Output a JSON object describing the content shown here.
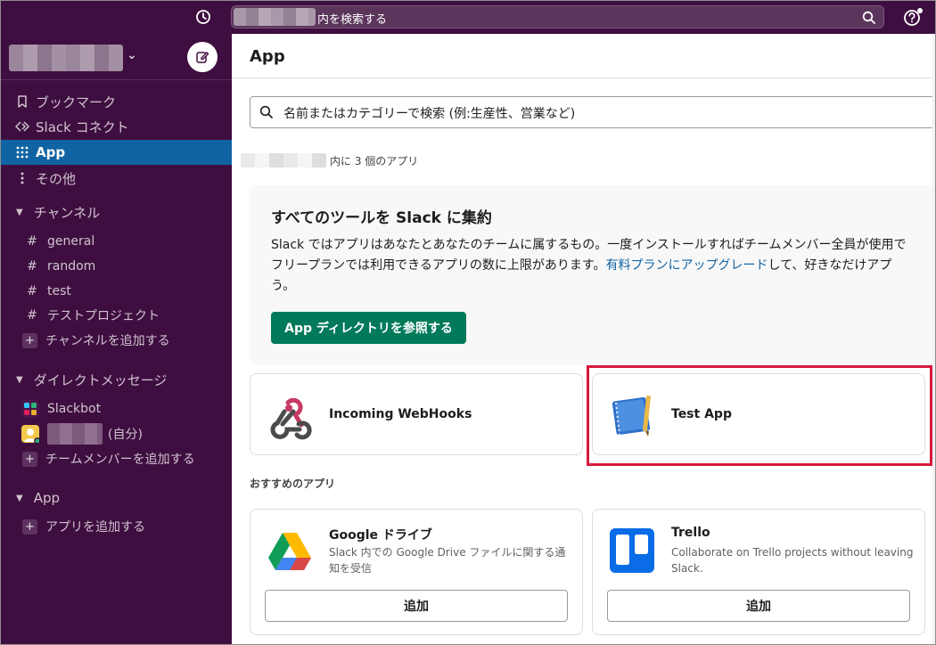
{
  "topbar": {
    "search_text": "内を検索する",
    "icons": [
      "clock-icon",
      "search-icon",
      "help-icon"
    ]
  },
  "sidebar": {
    "nav": [
      {
        "icon": "bookmark-icon",
        "label": "ブックマーク"
      },
      {
        "icon": "connect-icon",
        "label": "Slack コネクト"
      },
      {
        "icon": "apps-grid-icon",
        "label": "App",
        "active": true
      },
      {
        "icon": "more-icon",
        "label": "その他"
      }
    ],
    "channels_section": "チャンネル",
    "channels": [
      "general",
      "random",
      "test",
      "テストプロジェクト"
    ],
    "add_channel": "チャンネルを追加する",
    "dm_section": "ダイレクトメッセージ",
    "dms": [
      {
        "label": "Slackbot"
      },
      {
        "label": "(自分)"
      }
    ],
    "add_member": "チームメンバーを追加する",
    "app_section": "App",
    "add_app": "アプリを追加する",
    "colors": {
      "bg": "#3f0e40",
      "active": "#1164a3"
    }
  },
  "main": {
    "title": "App",
    "search_placeholder": "名前またはカテゴリーで検索 (例:生産性、営業など)",
    "count_text": "内に 3 個のアプリ",
    "promo": {
      "title": "すべてのツールを Slack に集約",
      "body_line1": "Slack ではアプリはあなたとあなたのチームに属するもの。一度インストールすればチームメンバー全員が使用で",
      "body_line2_pre": "フリープランでは利用できるアプリの数に上限があります。",
      "body_link": "有料プランにアップグレード",
      "body_line2_post": "して、好きなだけアプ",
      "body_line3": "う。",
      "button": "App ディレクトリを参照する"
    },
    "installed": [
      {
        "name": "Incoming WebHooks",
        "icon": "webhook-icon"
      },
      {
        "name": "Test App",
        "icon": "notebook-icon"
      }
    ],
    "recommended_label": "おすすめのアプリ",
    "recommended": [
      {
        "name": "Google ドライブ",
        "desc": "Slack 内での Google Drive ファイルに関する通知を受信",
        "button": "追加",
        "icon": "google-drive-icon"
      },
      {
        "name": "Trello",
        "desc": "Collaborate on Trello projects without leaving Slack.",
        "button": "追加",
        "icon": "trello-icon"
      }
    ]
  }
}
